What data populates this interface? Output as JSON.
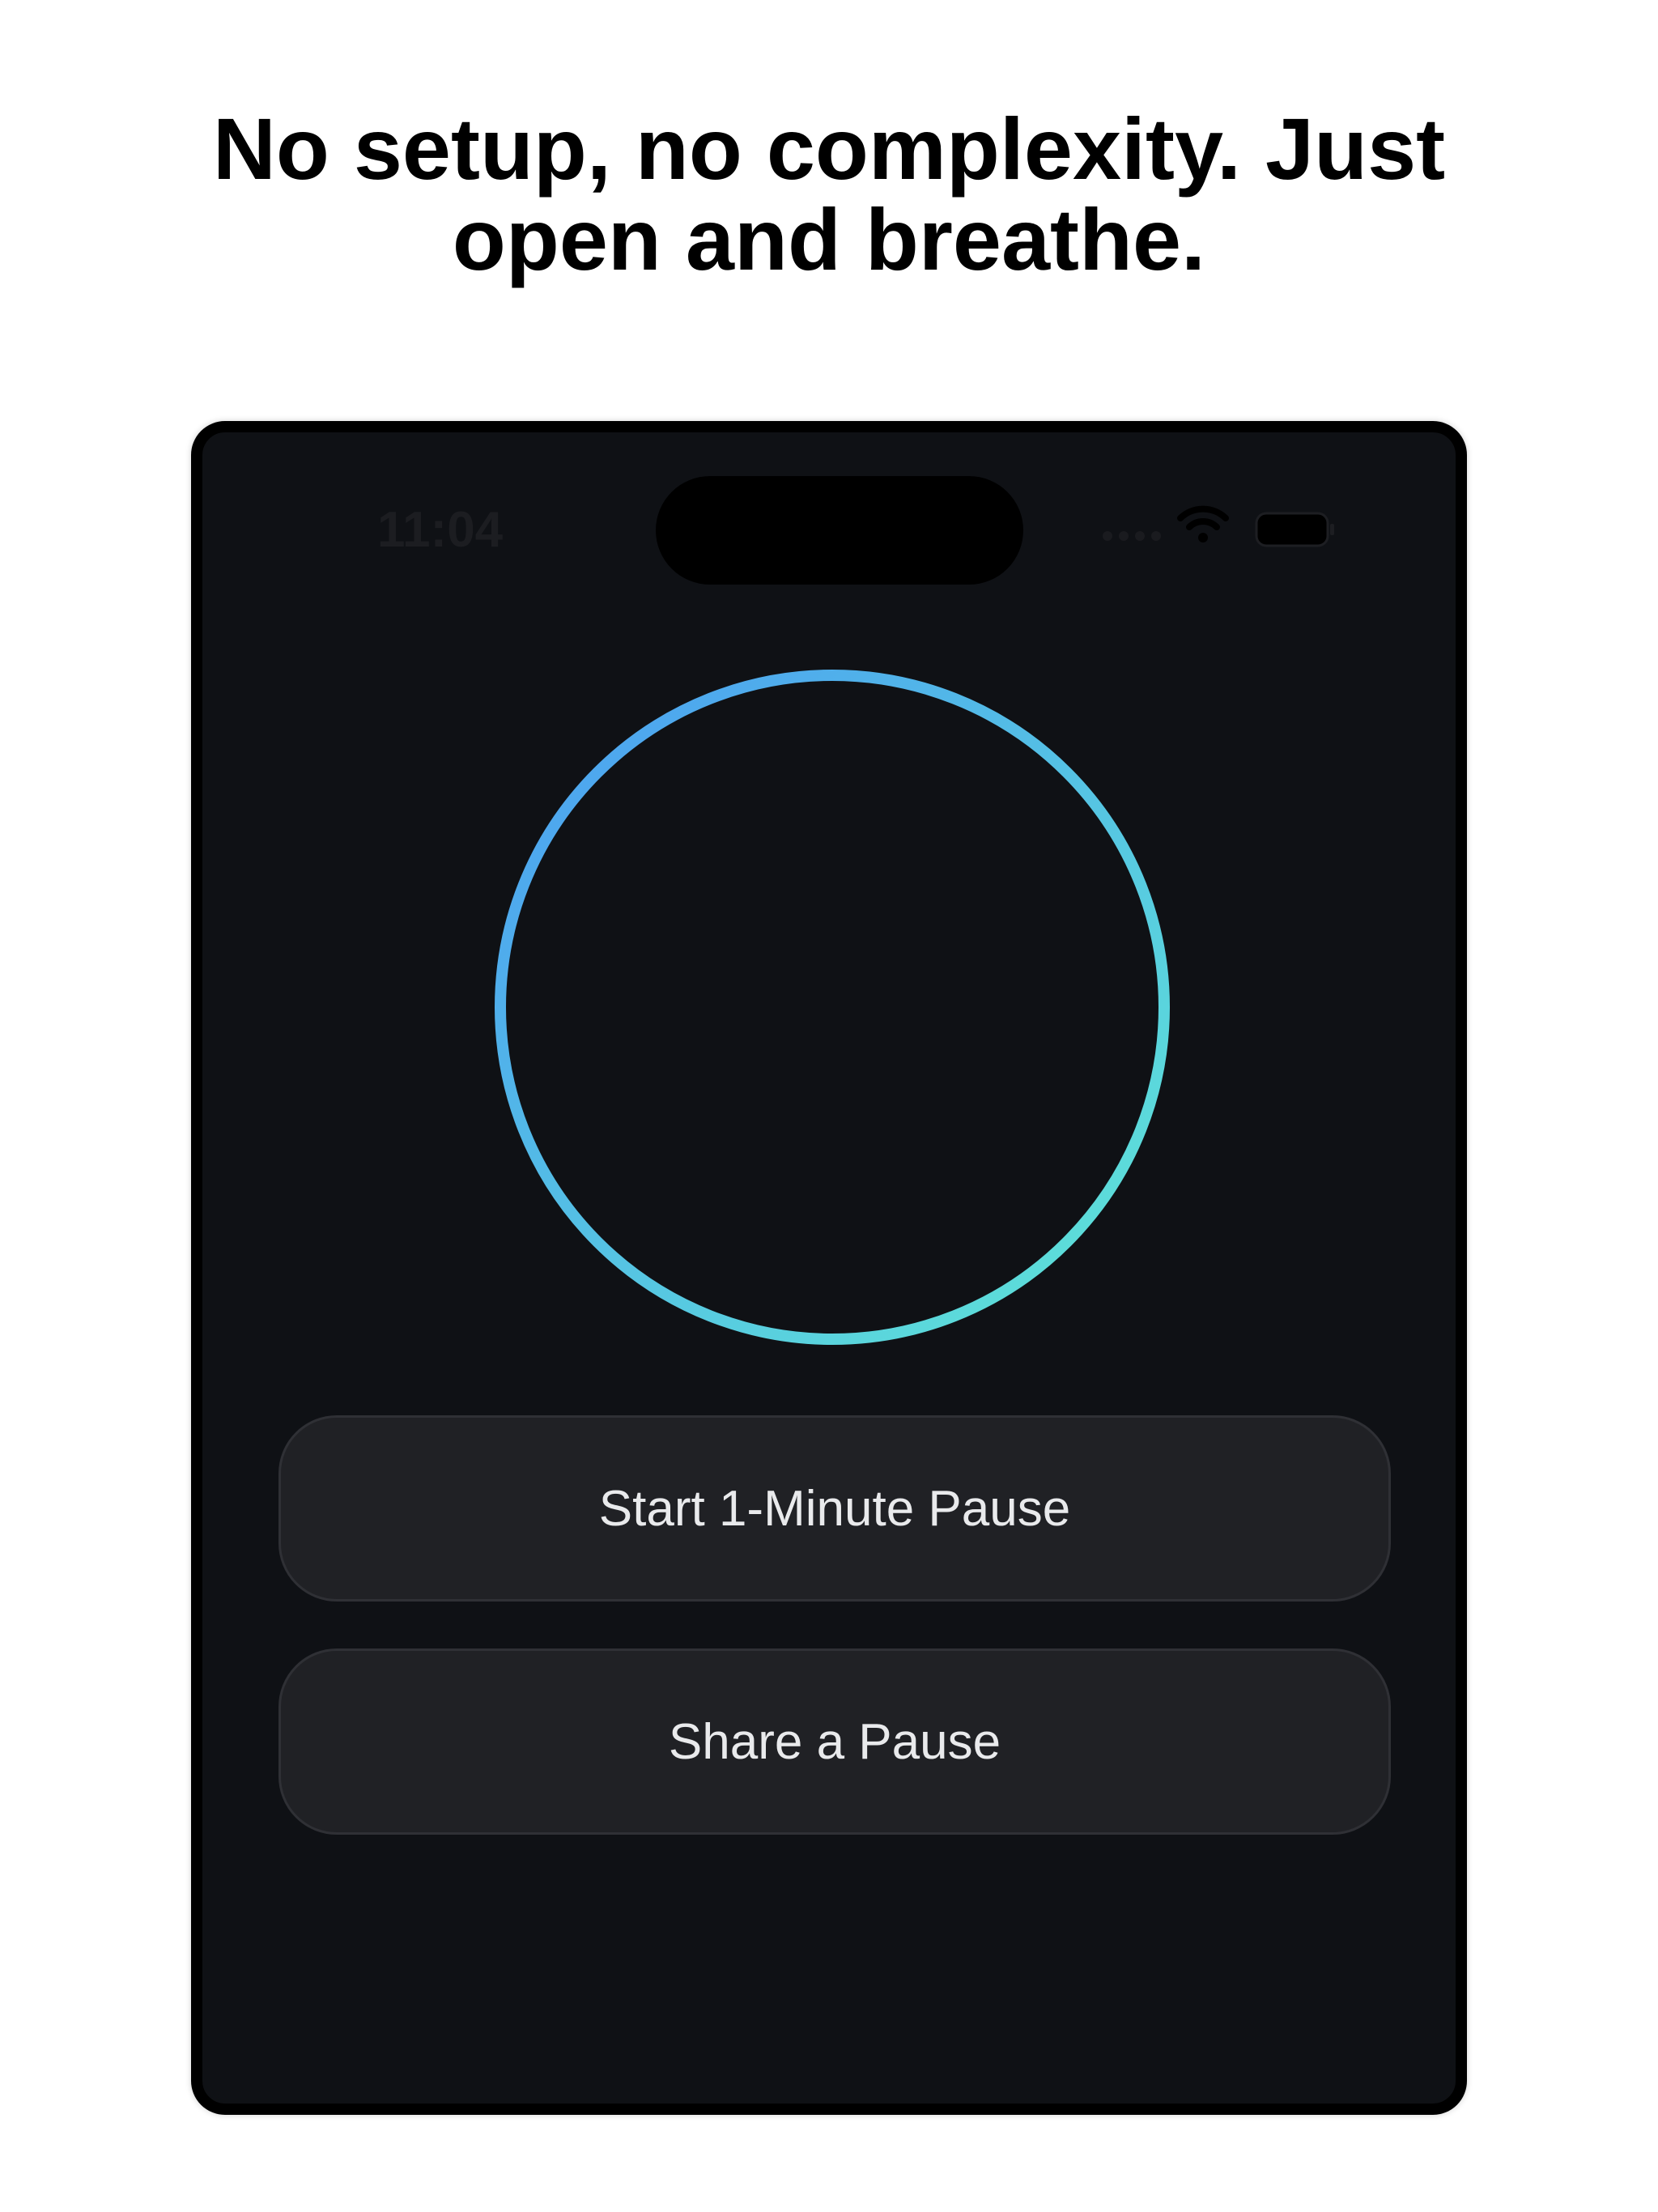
{
  "headline": "No setup, no complexity. Just open and breathe.",
  "status_bar": {
    "time": "11:04",
    "icons": [
      "cellular-signal-icon",
      "wifi-icon",
      "battery-icon"
    ]
  },
  "breathing_circle": {
    "gradient_start": "#4b9df2",
    "gradient_end": "#5fe6d6"
  },
  "buttons": {
    "start_label": "Start 1-Minute Pause",
    "share_label": "Share a Pause"
  },
  "colors": {
    "screen_background": "#0f1115",
    "button_background": "#202125",
    "button_text": "#e9eaec"
  }
}
